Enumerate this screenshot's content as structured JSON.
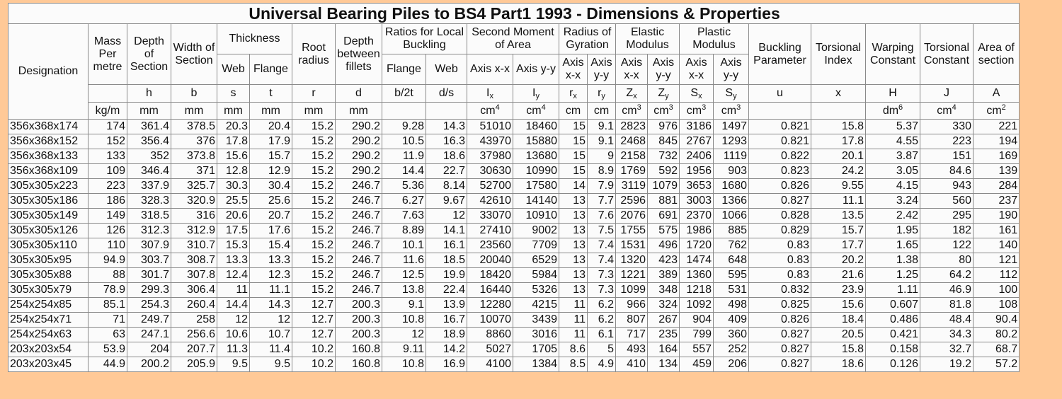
{
  "title": "Universal Bearing Piles to BS4 Part1 1993 - Dimensions & Properties",
  "headers": {
    "designation": "Designation",
    "mass": "Mass Per metre",
    "depth": "Depth of Section",
    "width": "Width of Section",
    "thickness": "Thickness",
    "web": "Web",
    "flange": "Flange",
    "root_radius": "Root radius",
    "depth_between_fillets": "Depth between fillets",
    "ratios": "Ratios for Local Buckling",
    "ratio_flange": "Flange",
    "ratio_web": "Web",
    "second_moment": "Second Moment of Area",
    "radius_gyration": "Radius of Gyration",
    "elastic_modulus": "Elastic Modulus",
    "plastic_modulus": "Plastic Modulus",
    "axis_xx": "Axis x-x",
    "axis_yy": "Axis y-y",
    "buckling": "Buckling Parameter",
    "torsional_index": "Torsional Index",
    "warping": "Warping Constant",
    "torsional_constant": "Torsional Constant",
    "area": "Area of section"
  },
  "symbols": [
    {
      "main": "h"
    },
    {
      "main": "b"
    },
    {
      "main": "s"
    },
    {
      "main": "t"
    },
    {
      "main": "r"
    },
    {
      "main": "d"
    },
    {
      "main": "b/2t"
    },
    {
      "main": "d/s"
    },
    {
      "main": "I",
      "sub": "x"
    },
    {
      "main": "I",
      "sub": "y"
    },
    {
      "main": "r",
      "sub": "x"
    },
    {
      "main": "r",
      "sub": "y"
    },
    {
      "main": "Z",
      "sub": "x"
    },
    {
      "main": "Z",
      "sub": "y"
    },
    {
      "main": "S",
      "sub": "x"
    },
    {
      "main": "S",
      "sub": "y"
    },
    {
      "main": "u"
    },
    {
      "main": "x"
    },
    {
      "main": "H"
    },
    {
      "main": "J"
    },
    {
      "main": "A"
    }
  ],
  "units": [
    {
      "main": "kg/m"
    },
    {
      "main": "mm"
    },
    {
      "main": "mm"
    },
    {
      "main": "mm"
    },
    {
      "main": "mm"
    },
    {
      "main": "mm"
    },
    {
      "main": "mm"
    },
    {
      "main": ""
    },
    {
      "main": ""
    },
    {
      "main": "cm",
      "sup": "4"
    },
    {
      "main": "cm",
      "sup": "4"
    },
    {
      "main": "cm"
    },
    {
      "main": "cm"
    },
    {
      "main": "cm",
      "sup": "3"
    },
    {
      "main": "cm",
      "sup": "3"
    },
    {
      "main": "cm",
      "sup": "3"
    },
    {
      "main": "cm",
      "sup": "3"
    },
    {
      "main": ""
    },
    {
      "main": ""
    },
    {
      "main": "dm",
      "sup": "6"
    },
    {
      "main": "cm",
      "sup": "4"
    },
    {
      "main": "cm",
      "sup": "2"
    }
  ],
  "rows": [
    [
      "356x368x174",
      "174",
      "361.4",
      "378.5",
      "20.3",
      "20.4",
      "15.2",
      "290.2",
      "9.28",
      "14.3",
      "51010",
      "18460",
      "15",
      "9.1",
      "2823",
      "976",
      "3186",
      "1497",
      "0.821",
      "15.8",
      "5.37",
      "330",
      "221"
    ],
    [
      "356x368x152",
      "152",
      "356.4",
      "376",
      "17.8",
      "17.9",
      "15.2",
      "290.2",
      "10.5",
      "16.3",
      "43970",
      "15880",
      "15",
      "9.1",
      "2468",
      "845",
      "2767",
      "1293",
      "0.821",
      "17.8",
      "4.55",
      "223",
      "194"
    ],
    [
      "356x368x133",
      "133",
      "352",
      "373.8",
      "15.6",
      "15.7",
      "15.2",
      "290.2",
      "11.9",
      "18.6",
      "37980",
      "13680",
      "15",
      "9",
      "2158",
      "732",
      "2406",
      "1119",
      "0.822",
      "20.1",
      "3.87",
      "151",
      "169"
    ],
    [
      "356x368x109",
      "109",
      "346.4",
      "371",
      "12.8",
      "12.9",
      "15.2",
      "290.2",
      "14.4",
      "22.7",
      "30630",
      "10990",
      "15",
      "8.9",
      "1769",
      "592",
      "1956",
      "903",
      "0.823",
      "24.2",
      "3.05",
      "84.6",
      "139"
    ],
    [
      "305x305x223",
      "223",
      "337.9",
      "325.7",
      "30.3",
      "30.4",
      "15.2",
      "246.7",
      "5.36",
      "8.14",
      "52700",
      "17580",
      "14",
      "7.9",
      "3119",
      "1079",
      "3653",
      "1680",
      "0.826",
      "9.55",
      "4.15",
      "943",
      "284"
    ],
    [
      "305x305x186",
      "186",
      "328.3",
      "320.9",
      "25.5",
      "25.6",
      "15.2",
      "246.7",
      "6.27",
      "9.67",
      "42610",
      "14140",
      "13",
      "7.7",
      "2596",
      "881",
      "3003",
      "1366",
      "0.827",
      "11.1",
      "3.24",
      "560",
      "237"
    ],
    [
      "305x305x149",
      "149",
      "318.5",
      "316",
      "20.6",
      "20.7",
      "15.2",
      "246.7",
      "7.63",
      "12",
      "33070",
      "10910",
      "13",
      "7.6",
      "2076",
      "691",
      "2370",
      "1066",
      "0.828",
      "13.5",
      "2.42",
      "295",
      "190"
    ],
    [
      "305x305x126",
      "126",
      "312.3",
      "312.9",
      "17.5",
      "17.6",
      "15.2",
      "246.7",
      "8.89",
      "14.1",
      "27410",
      "9002",
      "13",
      "7.5",
      "1755",
      "575",
      "1986",
      "885",
      "0.829",
      "15.7",
      "1.95",
      "182",
      "161"
    ],
    [
      "305x305x110",
      "110",
      "307.9",
      "310.7",
      "15.3",
      "15.4",
      "15.2",
      "246.7",
      "10.1",
      "16.1",
      "23560",
      "7709",
      "13",
      "7.4",
      "1531",
      "496",
      "1720",
      "762",
      "0.83",
      "17.7",
      "1.65",
      "122",
      "140"
    ],
    [
      "305x305x95",
      "94.9",
      "303.7",
      "308.7",
      "13.3",
      "13.3",
      "15.2",
      "246.7",
      "11.6",
      "18.5",
      "20040",
      "6529",
      "13",
      "7.4",
      "1320",
      "423",
      "1474",
      "648",
      "0.83",
      "20.2",
      "1.38",
      "80",
      "121"
    ],
    [
      "305x305x88",
      "88",
      "301.7",
      "307.8",
      "12.4",
      "12.3",
      "15.2",
      "246.7",
      "12.5",
      "19.9",
      "18420",
      "5984",
      "13",
      "7.3",
      "1221",
      "389",
      "1360",
      "595",
      "0.83",
      "21.6",
      "1.25",
      "64.2",
      "112"
    ],
    [
      "305x305x79",
      "78.9",
      "299.3",
      "306.4",
      "11",
      "11.1",
      "15.2",
      "246.7",
      "13.8",
      "22.4",
      "16440",
      "5326",
      "13",
      "7.3",
      "1099",
      "348",
      "1218",
      "531",
      "0.832",
      "23.9",
      "1.11",
      "46.9",
      "100"
    ],
    [
      "254x254x85",
      "85.1",
      "254.3",
      "260.4",
      "14.4",
      "14.3",
      "12.7",
      "200.3",
      "9.1",
      "13.9",
      "12280",
      "4215",
      "11",
      "6.2",
      "966",
      "324",
      "1092",
      "498",
      "0.825",
      "15.6",
      "0.607",
      "81.8",
      "108"
    ],
    [
      "254x254x71",
      "71",
      "249.7",
      "258",
      "12",
      "12",
      "12.7",
      "200.3",
      "10.8",
      "16.7",
      "10070",
      "3439",
      "11",
      "6.2",
      "807",
      "267",
      "904",
      "409",
      "0.826",
      "18.4",
      "0.486",
      "48.4",
      "90.4"
    ],
    [
      "254x254x63",
      "63",
      "247.1",
      "256.6",
      "10.6",
      "10.7",
      "12.7",
      "200.3",
      "12",
      "18.9",
      "8860",
      "3016",
      "11",
      "6.1",
      "717",
      "235",
      "799",
      "360",
      "0.827",
      "20.5",
      "0.421",
      "34.3",
      "80.2"
    ],
    [
      "203x203x54",
      "53.9",
      "204",
      "207.7",
      "11.3",
      "11.4",
      "10.2",
      "160.8",
      "9.11",
      "14.2",
      "5027",
      "1705",
      "8.6",
      "5",
      "493",
      "164",
      "557",
      "252",
      "0.827",
      "15.8",
      "0.158",
      "32.7",
      "68.7"
    ],
    [
      "203x203x45",
      "44.9",
      "200.2",
      "205.9",
      "9.5",
      "9.5",
      "10.2",
      "160.8",
      "10.8",
      "16.9",
      "4100",
      "1384",
      "8.5",
      "4.9",
      "410",
      "134",
      "459",
      "206",
      "0.827",
      "18.6",
      "0.126",
      "19.2",
      "57.2"
    ]
  ]
}
